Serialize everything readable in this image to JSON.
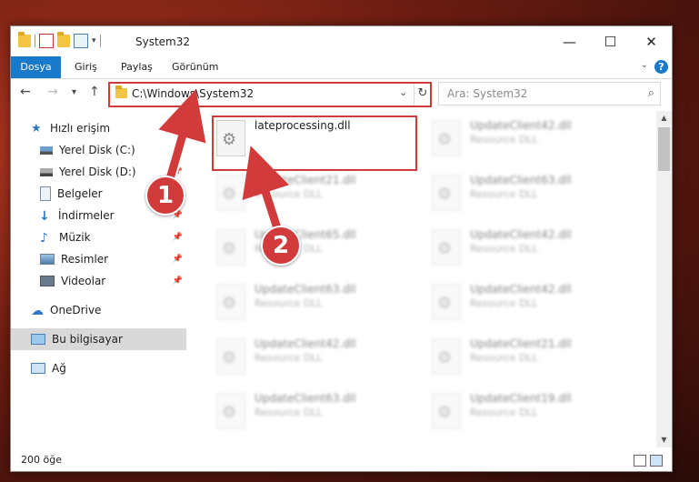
{
  "window": {
    "title": "System32",
    "controls": {
      "minimize": "—",
      "maximize": "☐",
      "close": "✕"
    }
  },
  "ribbon": {
    "tabs": [
      "Dosya",
      "Giriş",
      "Paylaş",
      "Görünüm"
    ],
    "help": "?"
  },
  "nav": {
    "back": "←",
    "forward": "→",
    "recent": "▾",
    "up": "↑"
  },
  "address": {
    "path": "C:\\Windows\\System32",
    "dropdown": "⌄",
    "refresh": "↻"
  },
  "search": {
    "placeholder": "Ara: System32",
    "icon": "search-icon"
  },
  "sidebar": {
    "items": [
      {
        "label": "Hızlı erişim",
        "icon": "star-icon"
      },
      {
        "label": "Yerel Disk (C:)",
        "icon": "drive-icon"
      },
      {
        "label": "Yerel Disk (D:)",
        "icon": "drive-icon"
      },
      {
        "label": "Belgeler",
        "icon": "documents-icon"
      },
      {
        "label": "İndirmeler",
        "icon": "download-icon"
      },
      {
        "label": "Müzik",
        "icon": "music-icon"
      },
      {
        "label": "Resimler",
        "icon": "pictures-icon"
      },
      {
        "label": "Videolar",
        "icon": "videos-icon"
      },
      {
        "label": "OneDrive",
        "icon": "cloud-icon"
      },
      {
        "label": "Bu bilgisayar",
        "icon": "computer-icon"
      },
      {
        "label": "Ağ",
        "icon": "network-icon"
      }
    ]
  },
  "files": [
    {
      "name": "lateprocessing.dll",
      "type": ""
    },
    {
      "name": "UpdateClient42.dll",
      "type": "Resource DLL"
    },
    {
      "name": "UpdateClient21.dll",
      "type": "Resource DLL"
    },
    {
      "name": "UpdateClient63.dll",
      "type": "Resource DLL"
    },
    {
      "name": "UpdateClient65.dll",
      "type": "Resource DLL"
    },
    {
      "name": "UpdateClient42.dll",
      "type": "Resource DLL"
    },
    {
      "name": "UpdateClient63.dll",
      "type": "Resource DLL"
    },
    {
      "name": "UpdateClient42.dll",
      "type": "Resource DLL"
    },
    {
      "name": "UpdateClient42.dll",
      "type": "Resource DLL"
    },
    {
      "name": "UpdateClient21.dll",
      "type": "Resource DLL"
    },
    {
      "name": "UpdateClient63.dll",
      "type": "Resource DLL"
    },
    {
      "name": "UpdateClient19.dll",
      "type": "Resource DLL"
    }
  ],
  "status": {
    "count": "200 öğe"
  },
  "annotations": {
    "step1": "1",
    "step2": "2",
    "color": "#d23b3b"
  }
}
